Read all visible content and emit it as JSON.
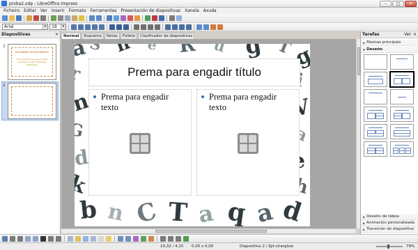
{
  "window": {
    "title": "proba2.odp - LibreOffice Impress",
    "buttons": {
      "minimize": "–",
      "maximize": "□",
      "close": "✕"
    }
  },
  "menu": [
    "Ficheiro",
    "Editar",
    "Ver",
    "Inserir",
    "Formato",
    "Ferramentas",
    "Presentación de diapositivas",
    "Xanela",
    "Axuda"
  ],
  "formatting": {
    "font_name": "Arial",
    "font_size": "18"
  },
  "slides_pane": {
    "title": "Diapositivas",
    "close": "×",
    "slides": [
      {
        "number": "1",
        "title": "PALABRAS HOMOGRAFAS",
        "body": "Son palabras que se escriben igual pero teñen diferente significado."
      },
      {
        "number": "2"
      }
    ]
  },
  "view_tabs": [
    "Normal",
    "Esquema",
    "Notas",
    "Folleto",
    "Clasificador de diapositivas"
  ],
  "slide": {
    "title_placeholder": "Prema para engadir título",
    "left_placeholder": "Prema para engadir texto",
    "right_placeholder": "Prema para engadir texto"
  },
  "tasks_pane": {
    "title": "Tarefas",
    "view_label": "Ver",
    "close": "×",
    "sections": {
      "master_pages": "Páxinas principais",
      "layouts": "Deseño",
      "table_design": "Deseño de táboa",
      "custom_animation": "Animación personalizada",
      "slide_transition": "Transición de diapositiva"
    }
  },
  "status": {
    "position": "10,32 / 4,15",
    "size": "0,00 x 0,00",
    "slide": "Diapositiva 2 / 2",
    "master": "lyt-charglow",
    "zoom": "79%"
  },
  "colors": {
    "accent": "#2b6eb8",
    "selection": "#c7d9f1",
    "workspace": "#a6a6a6"
  }
}
